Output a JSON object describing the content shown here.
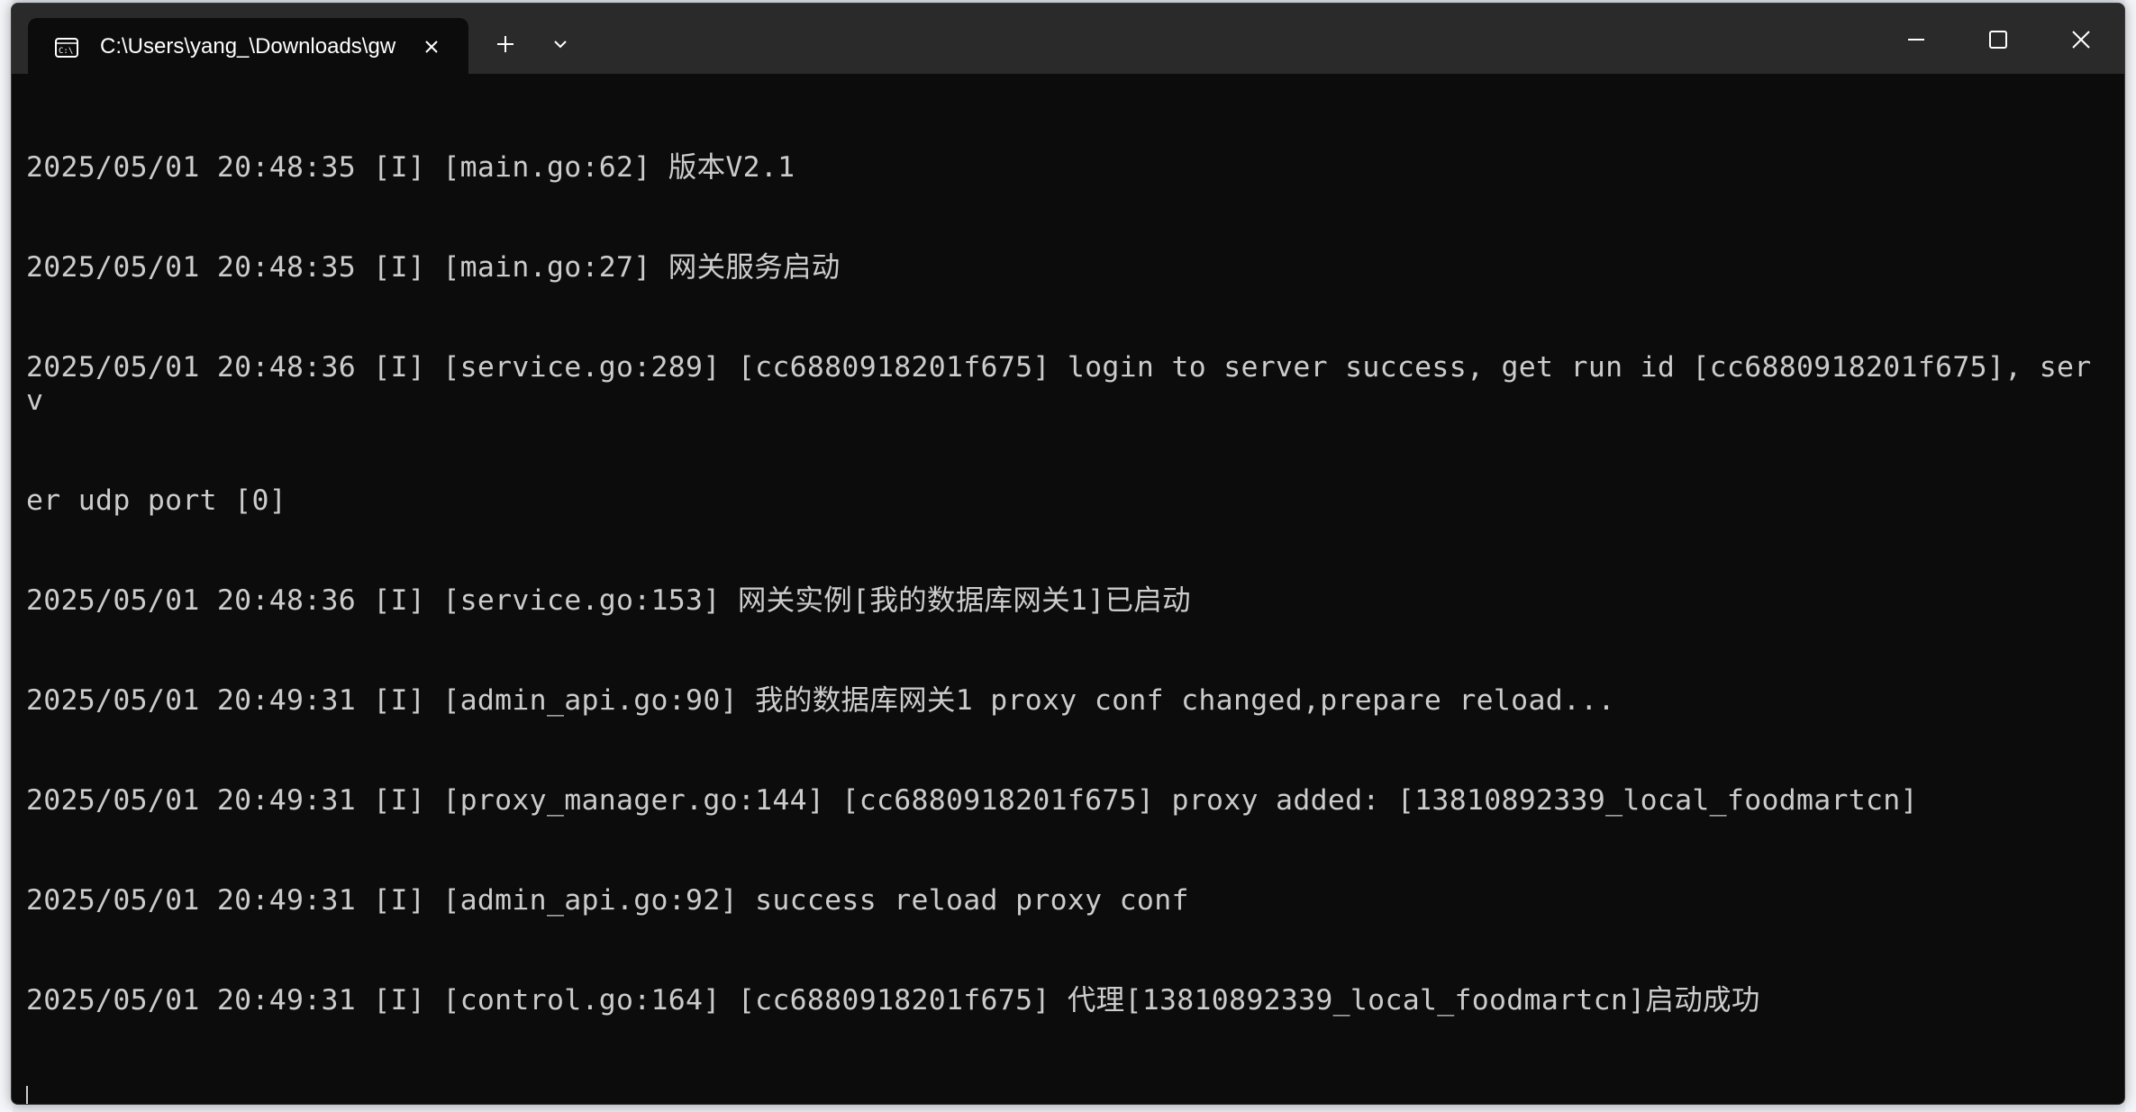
{
  "tab": {
    "title": "C:\\Users\\yang_\\Downloads\\gw",
    "icon": "terminal-icon"
  },
  "toolbar": {
    "new_tab_icon": "plus-icon",
    "dropdown_icon": "chevron-down-icon"
  },
  "window_controls": [
    "minimize-icon",
    "maximize-icon",
    "close-icon"
  ],
  "console": {
    "lines": [
      "2025/05/01 20:48:35 [I] [main.go:62] 版本V2.1",
      "2025/05/01 20:48:35 [I] [main.go:27] 网关服务启动",
      "2025/05/01 20:48:36 [I] [service.go:289] [cc6880918201f675] login to server success, get run id [cc6880918201f675], serv",
      "er udp port [0]",
      "2025/05/01 20:48:36 [I] [service.go:153] 网关实例[我的数据库网关1]已启动",
      "2025/05/01 20:49:31 [I] [admin_api.go:90] 我的数据库网关1 proxy conf changed,prepare reload...",
      "2025/05/01 20:49:31 [I] [proxy_manager.go:144] [cc6880918201f675] proxy added: [13810892339_local_foodmartcn]",
      "2025/05/01 20:49:31 [I] [admin_api.go:92] success reload proxy conf",
      "2025/05/01 20:49:31 [I] [control.go:164] [cc6880918201f675] 代理[13810892339_local_foodmartcn]启动成功"
    ]
  },
  "colors": {
    "console_bg": "#0c0c0c",
    "console_fg": "#cccccc",
    "titlebar_bg": "#2a2a2a"
  }
}
